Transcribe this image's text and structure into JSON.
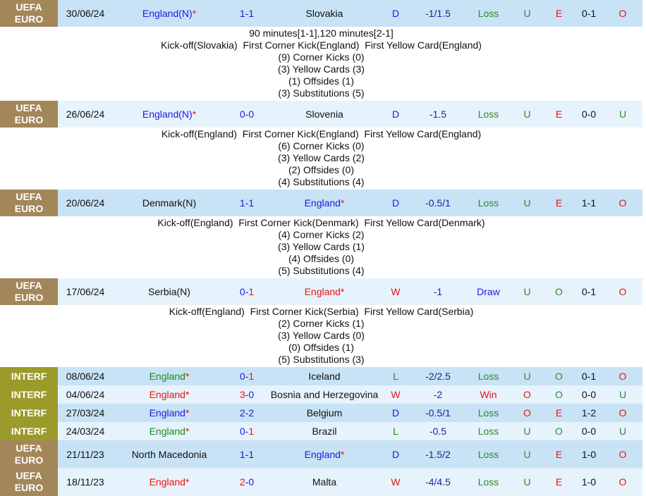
{
  "colors": {
    "euro_badge": "#a3875a",
    "interf_badge": "#9c9a2a",
    "row_dark": "#c8e3f5",
    "row_light": "#e6f3fc",
    "win": "#ee1111",
    "draw": "#1a1ae6",
    "loss": "#1a8a1a"
  },
  "matches": [
    {
      "league": "UEFA EURO",
      "date": "30/06/24",
      "home": "England(N)",
      "home_star": "*",
      "home_color": "bl",
      "score": [
        [
          "1-1",
          "bl"
        ]
      ],
      "away": "Slovakia",
      "away_color": "",
      "away_star": "",
      "result": "D",
      "handicap": "-1/1.5",
      "hc_result": "Loss",
      "hc_color": "og",
      "ou": "U",
      "ou_color": "tl",
      "oe": "E",
      "oe_color": "rd",
      "ht": "0-1",
      "ht_ou": "O",
      "ht_ou_color": "rd",
      "height": 38,
      "details": [
        "90 minutes[1-1],120 minutes[2-1]",
        "Kick-off(Slovakia)  First Corner Kick(England)  First Yellow Card(England)",
        "(9) Corner Kicks (0)",
        "(3) Yellow Cards (3)",
        "(1) Offsides (1)",
        "(3) Substitutions (5)"
      ]
    },
    {
      "league": "UEFA EURO",
      "date": "26/06/24",
      "home": "England(N)",
      "home_star": "*",
      "home_color": "bl",
      "score": [
        [
          "0-0",
          "bl"
        ]
      ],
      "away": "Slovenia",
      "away_color": "",
      "away_star": "",
      "result": "D",
      "handicap": "-1.5",
      "hc_result": "Loss",
      "hc_color": "og",
      "ou": "U",
      "ou_color": "tl",
      "oe": "E",
      "oe_color": "rd",
      "ht": "0-0",
      "ht_ou": "U",
      "ht_ou_color": "tl",
      "height": 38,
      "details": [
        "Kick-off(England)  First Corner Kick(England)  First Yellow Card(England)",
        "(6) Corner Kicks (0)",
        "(3) Yellow Cards (2)",
        "(2) Offsides (0)",
        "(4) Substitutions (4)"
      ]
    },
    {
      "league": "UEFA EURO",
      "date": "20/06/24",
      "home": "Denmark(N)",
      "home_star": "",
      "home_color": "",
      "score": [
        [
          "1-1",
          "bl"
        ]
      ],
      "away": "England",
      "away_star": "*",
      "away_color": "bl",
      "result": "D",
      "handicap": "-0.5/1",
      "hc_result": "Loss",
      "hc_color": "og",
      "ou": "U",
      "ou_color": "tl",
      "oe": "E",
      "oe_color": "rd",
      "ht": "1-1",
      "ht_ou": "O",
      "ht_ou_color": "rd",
      "height": 38,
      "details": [
        "Kick-off(England)  First Corner Kick(Denmark)  First Yellow Card(Denmark)",
        "(4) Corner Kicks (2)",
        "(3) Yellow Cards (1)",
        "(4) Offsides (0)",
        "(5) Substitutions (4)"
      ]
    },
    {
      "league": "UEFA EURO",
      "date": "17/06/24",
      "home": "Serbia(N)",
      "home_star": "",
      "home_color": "",
      "score": [
        [
          "0-",
          "bl"
        ],
        [
          "1",
          "rd"
        ]
      ],
      "away": "England",
      "away_star": "*",
      "away_color": "rd",
      "result": "W",
      "handicap": "-1",
      "hc_result": "Draw",
      "hc_color": "bl",
      "ou": "U",
      "ou_color": "tl",
      "oe": "O",
      "oe_color": "tl",
      "ht": "0-1",
      "ht_ou": "O",
      "ht_ou_color": "rd",
      "height": 38,
      "details": [
        "Kick-off(England)  First Corner Kick(Serbia)  First Yellow Card(Serbia)",
        "(2) Corner Kicks (1)",
        "(3) Yellow Cards (0)",
        "(0) Offsides (1)",
        "(5) Substitutions (3)"
      ]
    },
    {
      "league": "INTERF",
      "date": "08/06/24",
      "home": "England",
      "home_star": "*",
      "home_color": "gr",
      "score": [
        [
          "0-",
          "bl"
        ],
        [
          "1",
          "rd"
        ]
      ],
      "away": "Iceland",
      "away_color": "",
      "away_star": "",
      "result": "L",
      "handicap": "-2/2.5",
      "hc_result": "Loss",
      "hc_color": "og",
      "ou": "U",
      "ou_color": "tl",
      "oe": "O",
      "oe_color": "tl",
      "ht": "0-1",
      "ht_ou": "O",
      "ht_ou_color": "rd",
      "height": 26,
      "details": []
    },
    {
      "league": "INTERF",
      "date": "04/06/24",
      "home": "England",
      "home_star": "*",
      "home_color": "rd",
      "score": [
        [
          "3",
          "rd"
        ],
        [
          "-0",
          "bl"
        ]
      ],
      "away": "Bosnia and Herzegovina",
      "away_color": "",
      "away_star": "",
      "result": "W",
      "handicap": "-2",
      "hc_result": "Win",
      "hc_color": "rd",
      "ou": "O",
      "ou_color": "rd",
      "oe": "O",
      "oe_color": "tl",
      "ht": "0-0",
      "ht_ou": "U",
      "ht_ou_color": "tl",
      "height": 26,
      "details": []
    },
    {
      "league": "INTERF",
      "date": "27/03/24",
      "home": "England",
      "home_star": "*",
      "home_color": "bl",
      "score": [
        [
          "2-2",
          "bl"
        ]
      ],
      "away": "Belgium",
      "away_color": "",
      "away_star": "",
      "result": "D",
      "handicap": "-0.5/1",
      "hc_result": "Loss",
      "hc_color": "og",
      "ou": "O",
      "ou_color": "rd",
      "oe": "E",
      "oe_color": "rd",
      "ht": "1-2",
      "ht_ou": "O",
      "ht_ou_color": "rd",
      "height": 26,
      "details": []
    },
    {
      "league": "INTERF",
      "date": "24/03/24",
      "home": "England",
      "home_star": "*",
      "home_color": "gr",
      "score": [
        [
          "0-",
          "bl"
        ],
        [
          "1",
          "rd"
        ]
      ],
      "away": "Brazil",
      "away_color": "",
      "away_star": "",
      "result": "L",
      "handicap": "-0.5",
      "hc_result": "Loss",
      "hc_color": "og",
      "ou": "U",
      "ou_color": "tl",
      "oe": "O",
      "oe_color": "tl",
      "ht": "0-0",
      "ht_ou": "U",
      "ht_ou_color": "tl",
      "height": 26,
      "details": []
    },
    {
      "league": "UEFA EURO",
      "date": "21/11/23",
      "home": "North Macedonia",
      "home_star": "",
      "home_color": "",
      "score": [
        [
          "1-1",
          "bl"
        ]
      ],
      "away": "England",
      "away_star": "*",
      "away_color": "bl",
      "result": "D",
      "handicap": "-1.5/2",
      "hc_result": "Loss",
      "hc_color": "og",
      "ou": "U",
      "ou_color": "tl",
      "oe": "E",
      "oe_color": "rd",
      "ht": "1-0",
      "ht_ou": "O",
      "ht_ou_color": "rd",
      "height": 39,
      "details": []
    },
    {
      "league": "UEFA EURO",
      "date": "18/11/23",
      "home": "England",
      "home_star": "*",
      "home_color": "rd",
      "score": [
        [
          "2",
          "rd"
        ],
        [
          "-0",
          "bl"
        ]
      ],
      "away": "Malta",
      "away_color": "",
      "away_star": "",
      "result": "W",
      "handicap": "-4/4.5",
      "hc_result": "Loss",
      "hc_color": "og",
      "ou": "U",
      "ou_color": "tl",
      "oe": "E",
      "oe_color": "rd",
      "ht": "1-0",
      "ht_ou": "O",
      "ht_ou_color": "rd",
      "height": 40,
      "details": []
    }
  ]
}
